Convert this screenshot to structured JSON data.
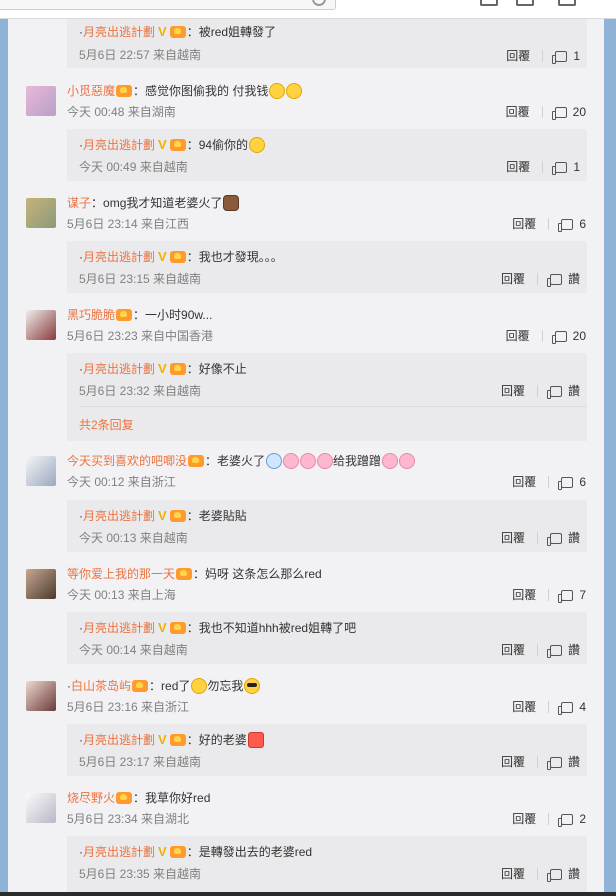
{
  "comments": [
    {
      "user": "月亮出逃計劃",
      "text": "被red姐轉發了",
      "time": "5月6日 22:57 来自越南",
      "reply_label": "回覆",
      "likes": "1",
      "is_reply": true
    },
    {
      "user": "小觅惡魔",
      "text": "感觉你图偷我的 付我钱",
      "time": "今天 00:48 来自湖南",
      "reply_label": "回覆",
      "likes": "20"
    },
    {
      "user": "月亮出逃計劃",
      "text": "94偷你的",
      "time": "今天 00:49 来自越南",
      "reply_label": "回覆",
      "likes": "1",
      "is_reply": true
    },
    {
      "user": "谋子",
      "text": "omg我才知道老婆火了",
      "time": "5月6日 23:14 来自江西",
      "reply_label": "回覆",
      "likes": "6"
    },
    {
      "user": "月亮出逃計劃",
      "text": "我也才發現。。。",
      "time": "5月6日 23:15 来自越南",
      "reply_label": "回覆",
      "likes": "讚",
      "is_reply": true
    },
    {
      "user": "黑巧脆脆",
      "text": "一小时90w...",
      "time": "5月6日 23:23 来自中国香港",
      "reply_label": "回覆",
      "likes": "20"
    },
    {
      "user": "月亮出逃計劃",
      "text": "好像不止",
      "time": "5月6日 23:32 来自越南",
      "reply_label": "回覆",
      "likes": "讚",
      "is_reply": true
    },
    {
      "user": "今天买到喜欢的吧唧没",
      "text": "老婆火了",
      "text2": "给我蹭蹭",
      "time": "今天 00:12 来自浙江",
      "reply_label": "回覆",
      "likes": "6"
    },
    {
      "user": "月亮出逃計劃",
      "text": "老婆貼貼",
      "time": "今天 00:13 来自越南",
      "reply_label": "回覆",
      "likes": "讚",
      "is_reply": true
    },
    {
      "user": "等你爱上我的那一天",
      "text": "妈呀 这条怎么那么red",
      "time": "今天 00:13 来自上海",
      "reply_label": "回覆",
      "likes": "7"
    },
    {
      "user": "月亮出逃計劃",
      "text": "我也不知道hhh被red姐轉了吧",
      "time": "今天 00:14 来自越南",
      "reply_label": "回覆",
      "likes": "讚",
      "is_reply": true
    },
    {
      "user": "白山茶岛屿",
      "text": "red了",
      "text2": "勿忘我",
      "time": "5月6日 23:16 来自浙江",
      "reply_label": "回覆",
      "likes": "4"
    },
    {
      "user": "月亮出逃計劃",
      "text": "好的老婆",
      "time": "5月6日 23:17 来自越南",
      "reply_label": "回覆",
      "likes": "讚",
      "is_reply": true
    },
    {
      "user": "烧尽野火",
      "text": "我草你好red",
      "time": "5月6日 23:34 来自湖北",
      "reply_label": "回覆",
      "likes": "2"
    },
    {
      "user": "月亮出逃計劃",
      "text": "是轉發出去的老婆red",
      "time": "5月6日 23:35 来自越南",
      "reply_label": "回覆",
      "likes": "讚",
      "is_reply": true
    }
  ],
  "more_replies": "共2条回复",
  "colors": {
    "username": "#eb7340",
    "meta": "#808080",
    "reply_bg": "#eaeaec",
    "panel_bg": "#f2f2f5"
  }
}
